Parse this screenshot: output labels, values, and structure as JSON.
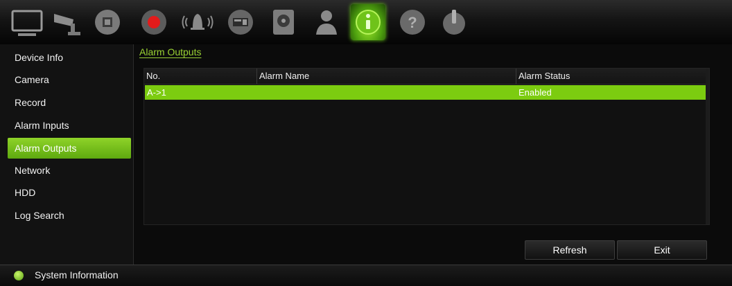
{
  "toolbar": {
    "icons": [
      "display-icon",
      "camera-icon",
      "network-icon",
      "record-icon",
      "alarm-icon",
      "device-icon",
      "hdd-icon",
      "user-icon",
      "info-icon",
      "help-icon",
      "power-icon"
    ],
    "active": "info-icon"
  },
  "sidebar": {
    "items": [
      {
        "label": "Device Info"
      },
      {
        "label": "Camera"
      },
      {
        "label": "Record"
      },
      {
        "label": "Alarm Inputs"
      },
      {
        "label": "Alarm Outputs"
      },
      {
        "label": "Network"
      },
      {
        "label": "HDD"
      },
      {
        "label": "Log Search"
      }
    ],
    "active": "Alarm Outputs"
  },
  "main": {
    "title": "Alarm Outputs",
    "columns": [
      "No.",
      "Alarm Name",
      "Alarm Status"
    ],
    "rows": [
      {
        "no": "A->1",
        "name": "",
        "status": "Enabled"
      }
    ],
    "buttons": {
      "refresh": "Refresh",
      "exit": "Exit"
    }
  },
  "statusbar": {
    "text": "System Information"
  },
  "colors": {
    "accent": "#7ccc10",
    "background": "#0d0d0d"
  }
}
